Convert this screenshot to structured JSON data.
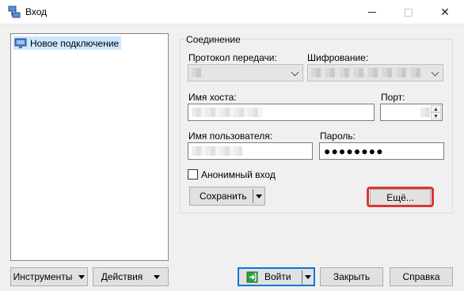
{
  "window": {
    "title": "Вход"
  },
  "sites": {
    "items": [
      {
        "label": "Новое подключение",
        "selected": true
      }
    ]
  },
  "connection": {
    "group_title": "Соединение",
    "protocol_label": "Протокол передачи:",
    "encryption_label": "Шифрование:",
    "host_label": "Имя хоста:",
    "port_label": "Порт:",
    "username_label": "Имя пользователя:",
    "password_label": "Пароль:",
    "password_value": "●●●●●●●●",
    "anonymous_label": "Анонимный вход",
    "save_label": "Сохранить",
    "more_label": "Ещё..."
  },
  "footer": {
    "tools_label": "Инструменты",
    "actions_label": "Действия",
    "login_label": "Войти",
    "close_label": "Закрыть",
    "help_label": "Справка"
  },
  "colors": {
    "accent": "#0078d7",
    "highlight": "#d9382f",
    "selection": "#cce8ff"
  }
}
